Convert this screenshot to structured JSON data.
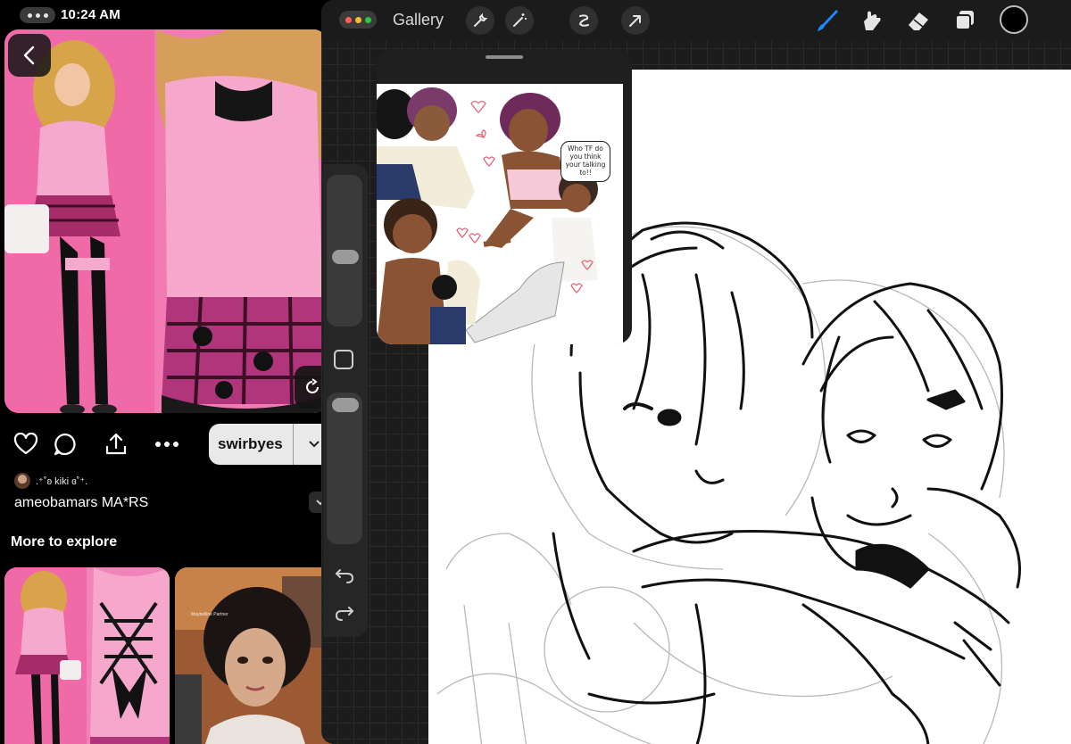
{
  "status_bar": {
    "time": "10:24 AM"
  },
  "pin": {
    "board_name": "swirbyes",
    "creator": ".⁺˚ʚ kiki ɞ˚⁺.",
    "title": "ameobamars MA*RS",
    "more_title": "More to explore",
    "explore_sponsor": "Maybelline Partner"
  },
  "drawing_app": {
    "gallery_label": "Gallery",
    "toolbar_icons": [
      "wrench-icon",
      "magic-wand-icon",
      "selection-icon",
      "transform-arrow-icon"
    ],
    "right_tools": [
      "brush-icon",
      "smudge-icon",
      "eraser-icon",
      "layers-icon"
    ],
    "active_tool": "brush-icon",
    "current_color": "#000000",
    "accent_color": "#1a8cff",
    "reference_speech": "Who TF do you think your talking to!!"
  }
}
